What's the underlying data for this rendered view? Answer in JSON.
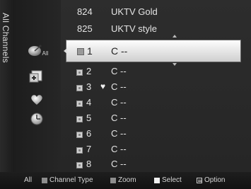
{
  "side_title": "All Channels",
  "mode_icons": [
    {
      "icon": "all-channels-icon",
      "label": "All"
    },
    {
      "icon": "added-channels-icon"
    },
    {
      "icon": "favourite-heart-icon"
    },
    {
      "icon": "programmed-clock-icon"
    }
  ],
  "channels_above": [
    {
      "number": "824",
      "name": "UKTV Gold"
    },
    {
      "number": "825",
      "name": "UKTV style"
    }
  ],
  "selected": {
    "number": "1",
    "name": "C --"
  },
  "channels": [
    {
      "number": "2",
      "name": "C --",
      "favourite": false
    },
    {
      "number": "3",
      "name": "C --",
      "favourite": true
    },
    {
      "number": "4",
      "name": "C --",
      "favourite": false
    },
    {
      "number": "5",
      "name": "C --",
      "favourite": false
    },
    {
      "number": "6",
      "name": "C --",
      "favourite": false
    },
    {
      "number": "7",
      "name": "C --",
      "favourite": false
    },
    {
      "number": "8",
      "name": "C --",
      "favourite": false
    }
  ],
  "favourite_symbol": "♥",
  "bottom_bar": {
    "all": "All",
    "channel_type": "Channel Type",
    "zoom": "Zoom",
    "select": "Select",
    "option": "Option"
  }
}
